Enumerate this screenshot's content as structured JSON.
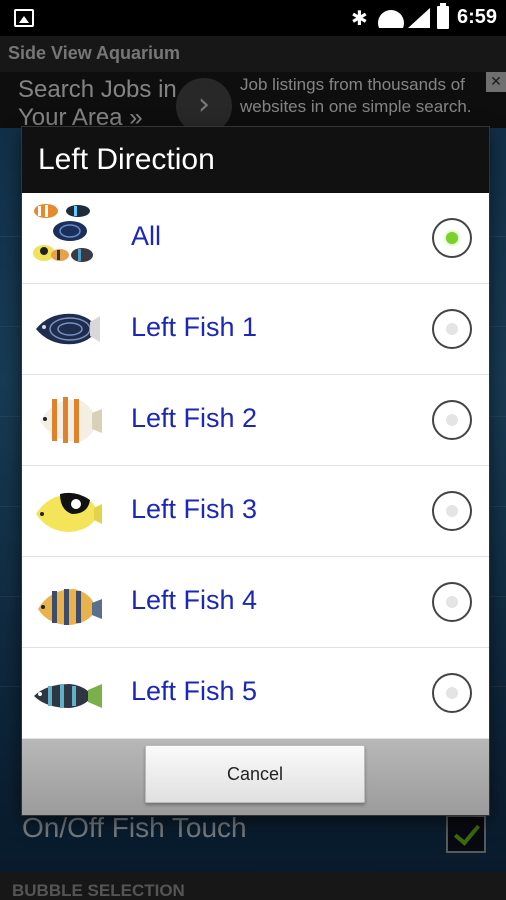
{
  "status_bar": {
    "time": "6:59",
    "bluetooth_icon": "bluetooth-icon",
    "wifi_icon": "wifi-icon",
    "signal_icon": "signal-icon",
    "battery_icon": "battery-icon",
    "notification_icon": "image-icon"
  },
  "background_app": {
    "title": "Side View Aquarium",
    "ad": {
      "title": "Search Jobs in Your Area »",
      "text": "Job listings from thousands of websites in one simple search."
    },
    "fish_touch_label": "On/Off Fish Touch",
    "fish_touch_checked": true,
    "section_header": "BUBBLE SELECTION"
  },
  "dialog": {
    "title": "Left Direction",
    "options": [
      {
        "label": "All",
        "selected": true,
        "thumb": "fish-group"
      },
      {
        "label": "Left Fish 1",
        "selected": false,
        "thumb": "angelfish"
      },
      {
        "label": "Left Fish 2",
        "selected": false,
        "thumb": "butterflyfish-orange"
      },
      {
        "label": "Left Fish 3",
        "selected": false,
        "thumb": "butterflyfish-yellow"
      },
      {
        "label": "Left Fish 4",
        "selected": false,
        "thumb": "butterflyfish-striped"
      },
      {
        "label": "Left Fish 5",
        "selected": false,
        "thumb": "black-striped-fish"
      }
    ],
    "cancel_label": "Cancel",
    "colors": {
      "label": "#1a27b8",
      "radio_selected": "#7bd02a",
      "header_bg": "#111111"
    }
  }
}
